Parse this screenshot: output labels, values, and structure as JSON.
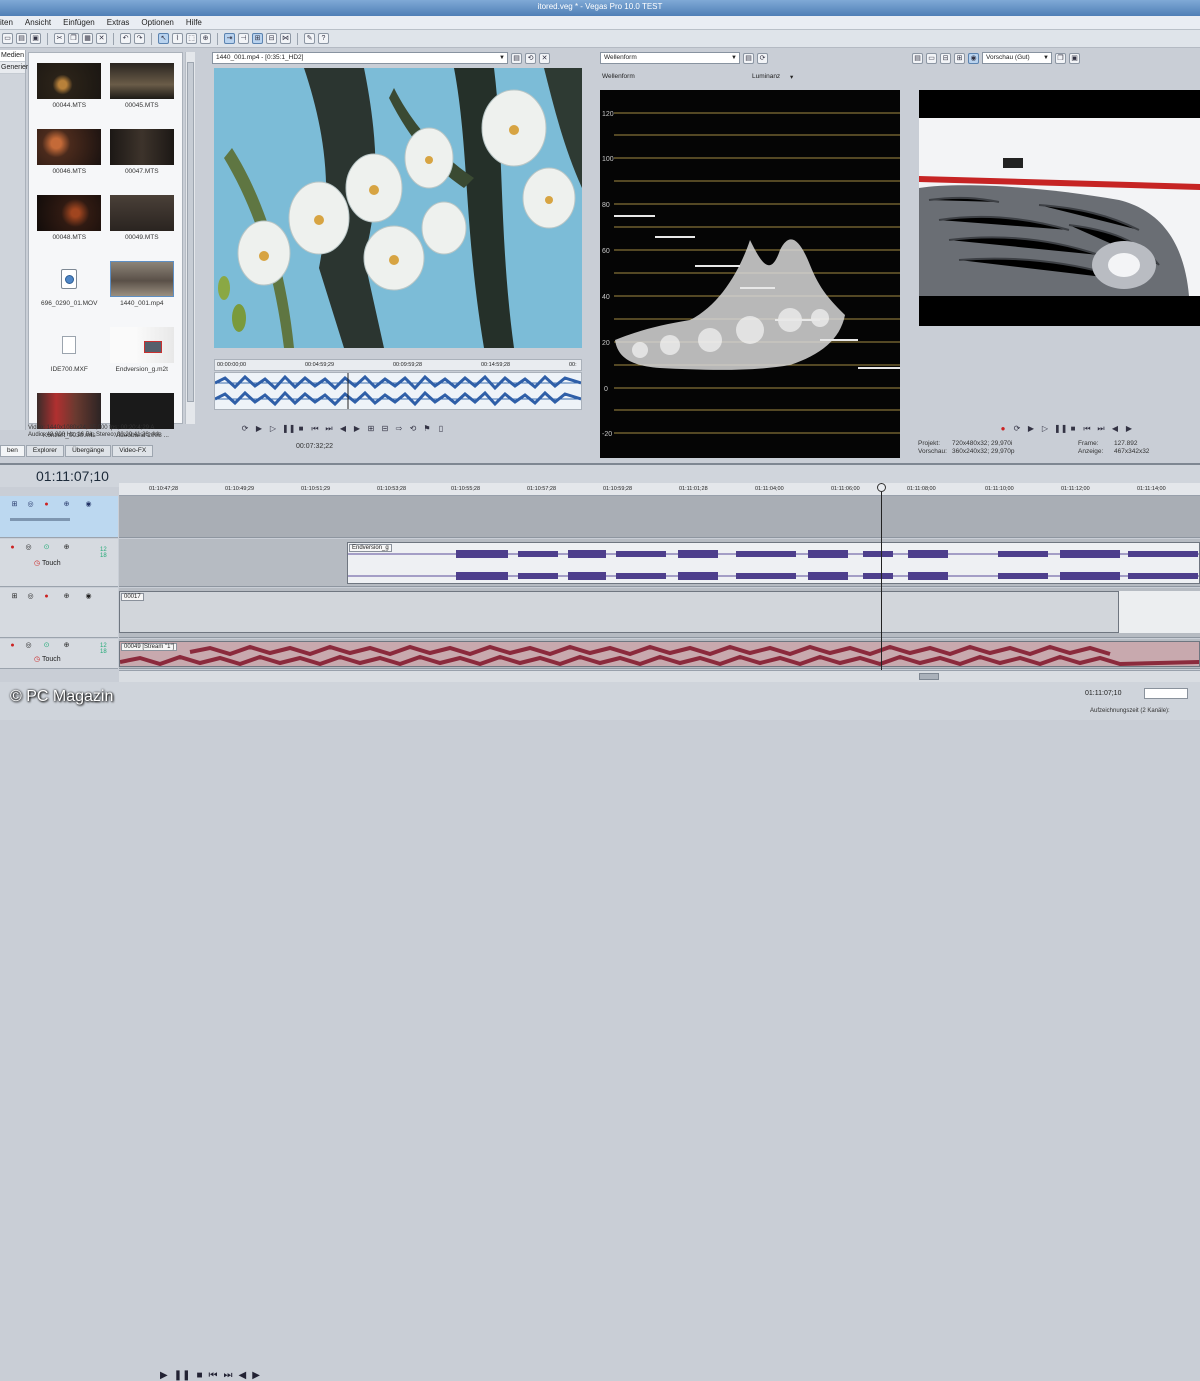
{
  "title": "itored.veg * - Vegas Pro 10.0 TEST",
  "menu": [
    "iten",
    "Ansicht",
    "Einfügen",
    "Extras",
    "Optionen",
    "Hilfe"
  ],
  "media": {
    "nav": [
      "Medien",
      "Generiert"
    ],
    "files": [
      {
        "name": "00044.MTS",
        "kind": "video-dark"
      },
      {
        "name": "00045.MTS",
        "kind": "video-dark"
      },
      {
        "name": "00046.MTS",
        "kind": "video-dark"
      },
      {
        "name": "00047.MTS",
        "kind": "video-dark"
      },
      {
        "name": "00048.MTS",
        "kind": "video-dark"
      },
      {
        "name": "00049.MTS",
        "kind": "video-dark"
      },
      {
        "name": "696_0290_01.MOV",
        "kind": "quicktime"
      },
      {
        "name": "1440_001.mp4",
        "kind": "video-crowd"
      },
      {
        "name": "IDE700.MXF",
        "kind": "doc"
      },
      {
        "name": "Endversion_g.m2t",
        "kind": "video-light"
      },
      {
        "name": "Konzert_0030.mts",
        "kind": "video-crowd"
      },
      {
        "name": "Videoband 2008 ...",
        "kind": "video-black"
      }
    ],
    "info_line1": "Video: 1440x1080x24; 25,000 fps; 00:20:4;29 A",
    "info_line2": "Audio: 48.000 Hz; 16 Bit; Stereo; 00:20:41;26; AA",
    "tabs": [
      "ben",
      "Explorer",
      "Übergänge",
      "Video-FX"
    ]
  },
  "trimmer": {
    "file": "1440_001.mp4 - [0:35:1_HD2]",
    "ruler": [
      "00:00:00;00",
      "00:04:59;29",
      "00:09:59;28",
      "00:14:59;28",
      "00:"
    ],
    "timecode": "00:07:32;22"
  },
  "scope": {
    "mode": "Wellenform",
    "sublabel_left": "Wellenform",
    "sublabel_right": "Luminanz",
    "ticks": [
      "120",
      "100",
      "80",
      "60",
      "40",
      "20",
      "0",
      "-20"
    ]
  },
  "preview": {
    "mode": "Vorschau (Gut)",
    "info": {
      "projekt_label": "Projekt:",
      "projekt_value": "720x480x32; 29,970i",
      "vorschau_label": "Vorschau:",
      "vorschau_value": "360x240x32; 29,970p",
      "frame_label": "Frame:",
      "frame_value": "127.892",
      "anzeige_label": "Anzeige:",
      "anzeige_value": "467x342x32"
    }
  },
  "timeline": {
    "timecode": "01:11:07;10",
    "ruler": [
      "01:10:47;28",
      "01:10:49;29",
      "01:10:51;29",
      "01:10:53;28",
      "01:10:55;28",
      "01:10:57;28",
      "01:10:59;28",
      "01:11:01;28",
      "01:11:04;00",
      "01:11:06;00",
      "01:11:08;00",
      "01:11:10;00",
      "01:11:12;00",
      "01:11:14;00"
    ],
    "tracks": [
      {
        "clip": "",
        "touch": "",
        "num": ""
      },
      {
        "clip": "Endversion_g",
        "touch": "Touch",
        "num": "12\n18"
      },
      {
        "clip": "00017",
        "touch": "",
        "num": ""
      },
      {
        "clip": "00049 [Stream \"1\"]",
        "touch": "Touch",
        "num": "12\n18"
      }
    ],
    "end_timecode": "01:11:07;10",
    "status": "Aufzeichnungszeit (2 Kanäle):"
  },
  "watermark": "© PC Magazin"
}
